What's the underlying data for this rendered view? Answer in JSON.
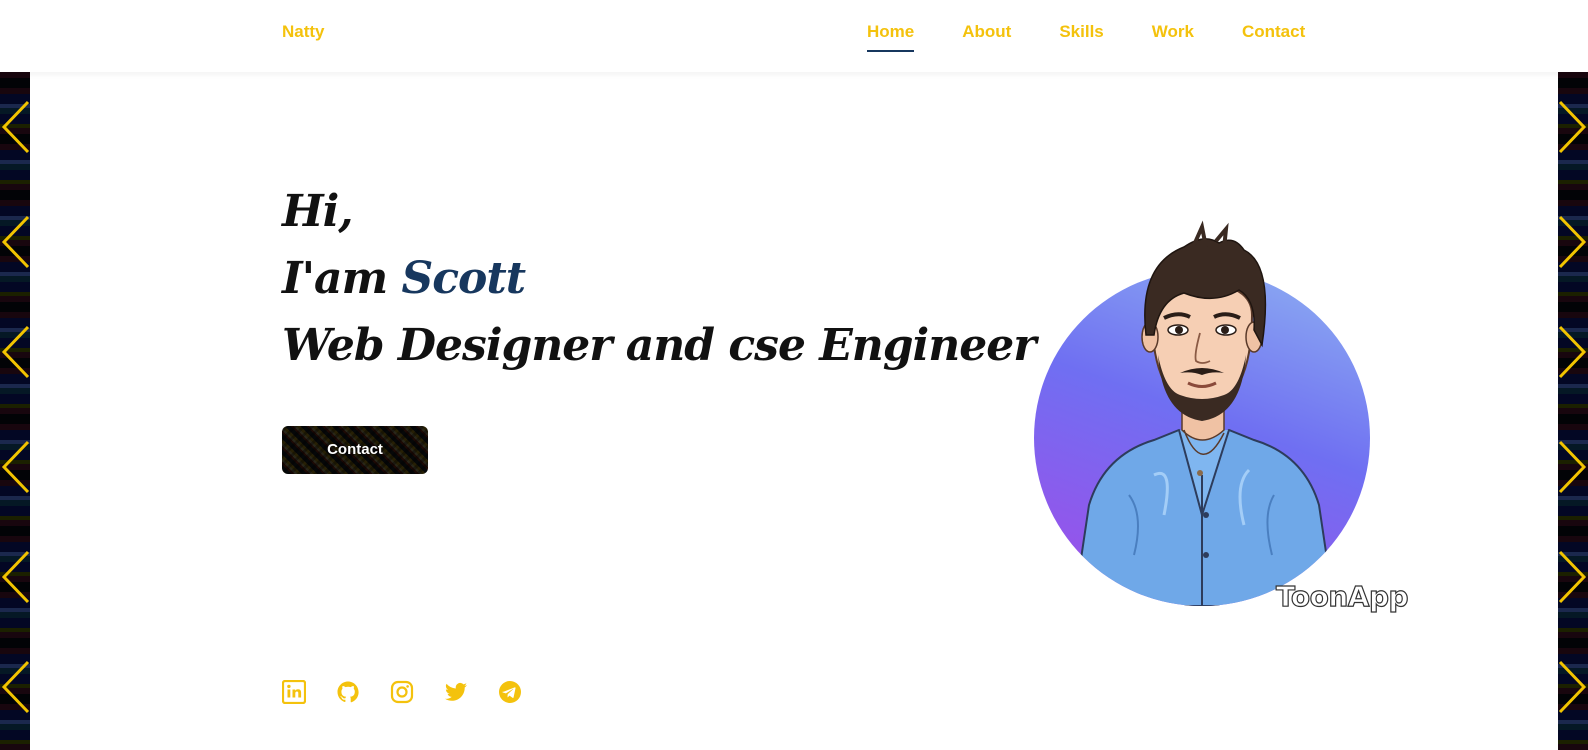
{
  "header": {
    "logo": "Natty",
    "nav": [
      {
        "label": "Home",
        "active": true
      },
      {
        "label": "About",
        "active": false
      },
      {
        "label": "Skills",
        "active": false
      },
      {
        "label": "Work",
        "active": false
      },
      {
        "label": "Contact",
        "active": false
      }
    ]
  },
  "hero": {
    "greeting": "Hi,",
    "intro_prefix": "I'am",
    "name": "Scott",
    "role": "Web Designer and cse Engineer",
    "cta_label": "Contact"
  },
  "socials": [
    {
      "name": "linkedin-icon"
    },
    {
      "name": "github-icon"
    },
    {
      "name": "instagram-icon"
    },
    {
      "name": "twitter-icon"
    },
    {
      "name": "telegram-icon"
    }
  ],
  "avatar": {
    "watermark": "ToonApp"
  },
  "colors": {
    "accent": "#f4c20d",
    "name_color": "#17375e",
    "underline": "#17375e",
    "heading": "#111111"
  }
}
